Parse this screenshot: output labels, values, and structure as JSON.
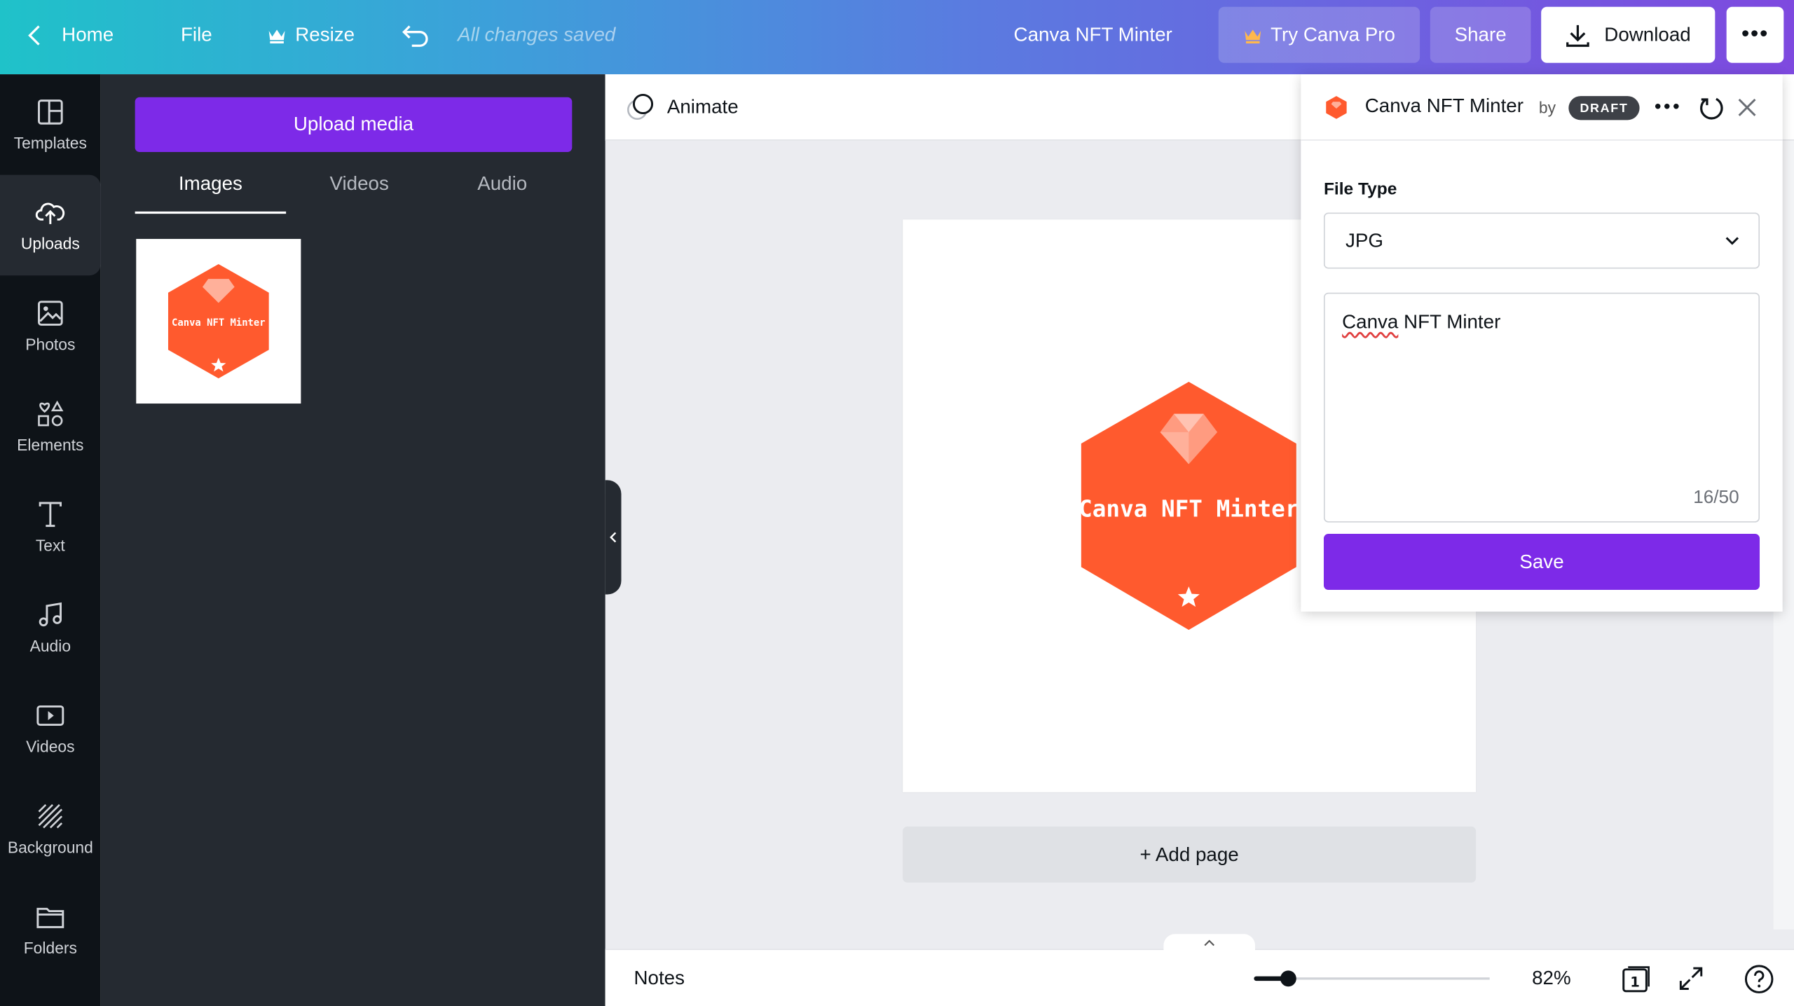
{
  "topbar": {
    "home_label": "Home",
    "file_label": "File",
    "resize_label": "Resize",
    "save_status": "All changes saved",
    "design_title": "Canva NFT Minter",
    "try_pro_label": "Try Canva Pro",
    "share_label": "Share",
    "download_label": "Download",
    "more_label": "•••"
  },
  "rail": {
    "items": [
      {
        "label": "Templates",
        "icon": "templates-icon"
      },
      {
        "label": "Uploads",
        "icon": "upload-cloud-icon",
        "active": true
      },
      {
        "label": "Photos",
        "icon": "photo-icon"
      },
      {
        "label": "Elements",
        "icon": "shapes-icon"
      },
      {
        "label": "Text",
        "icon": "text-icon"
      },
      {
        "label": "Audio",
        "icon": "music-note-icon"
      },
      {
        "label": "Videos",
        "icon": "video-icon"
      },
      {
        "label": "Background",
        "icon": "background-pattern-icon"
      },
      {
        "label": "Folders",
        "icon": "folder-icon"
      }
    ]
  },
  "panel": {
    "upload_label": "Upload media",
    "tabs": [
      "Images",
      "Videos",
      "Audio"
    ],
    "active_tab": "Images"
  },
  "canvas": {
    "animate_label": "Animate",
    "badge_text": "Canva NFT Minter",
    "add_page_label": "+ Add page",
    "badge_color": "#ff5a2e"
  },
  "bottombar": {
    "notes_label": "Notes",
    "zoom": "82%",
    "page_count": "1"
  },
  "popup": {
    "app_name": "Canva NFT Minter",
    "by_label": "by",
    "draft_label": "DRAFT",
    "file_type_label": "File Type",
    "file_type_value": "JPG",
    "name_value_word1": "Canva",
    "name_value_rest": " NFT Minter",
    "char_count": "16/50",
    "save_label": "Save"
  },
  "colors": {
    "accent_purple": "#7d2ae8",
    "dark_rail": "#0e1318",
    "panel": "#252a31"
  }
}
